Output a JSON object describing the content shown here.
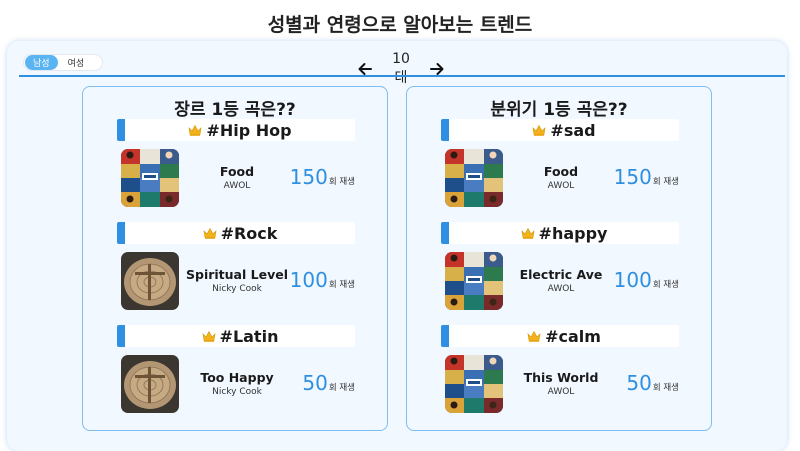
{
  "page_title": "성별과 연령으로 알아보는 트렌드",
  "gender_toggle": {
    "options": [
      "남성",
      "여성"
    ],
    "active": "남성"
  },
  "age_nav": {
    "label": "10대"
  },
  "genre_card": {
    "title": "장르 1등 곡은??",
    "items": [
      {
        "tag": "#Hip Hop",
        "title": "Food",
        "artist": "AWOL",
        "plays": "150",
        "plays_unit": "회 재생"
      },
      {
        "tag": "#Rock",
        "title": "Spiritual Level",
        "artist": "Nicky Cook",
        "plays": "100",
        "plays_unit": "회 재생"
      },
      {
        "tag": "#Latin",
        "title": "Too Happy",
        "artist": "Nicky Cook",
        "plays": "50",
        "plays_unit": "회 재생"
      }
    ]
  },
  "mood_card": {
    "title": "분위기 1등 곡은??",
    "items": [
      {
        "tag": "#sad",
        "title": "Food",
        "artist": "AWOL",
        "plays": "150",
        "plays_unit": "회 재생"
      },
      {
        "tag": "#happy",
        "title": "Electric Ave",
        "artist": "AWOL",
        "plays": "100",
        "plays_unit": "회 재생"
      },
      {
        "tag": "#calm",
        "title": "This World",
        "artist": "AWOL",
        "plays": "50",
        "plays_unit": "회 재생"
      }
    ]
  },
  "colors": {
    "accent": "#2f8fe0",
    "toggle_active": "#5ab4f2",
    "crown": "#f2b21b"
  },
  "icons": {
    "prev": "arrow-left-icon",
    "next": "arrow-right-icon",
    "crown": "crown-icon"
  }
}
